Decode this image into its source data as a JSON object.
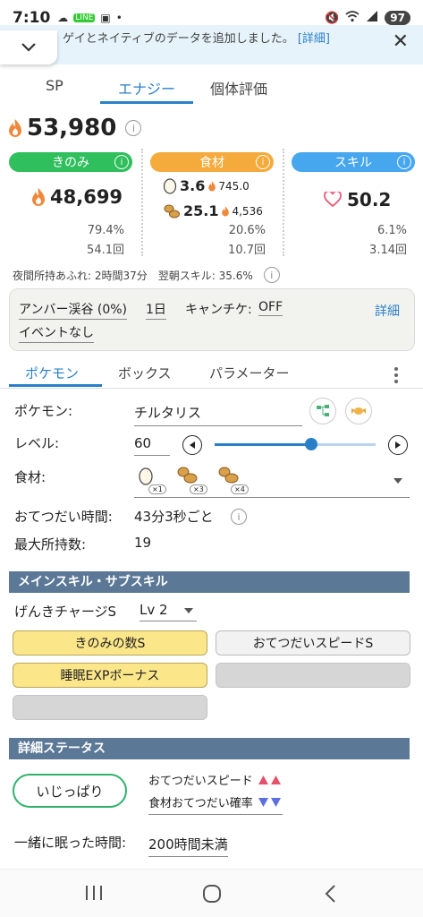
{
  "status_bar": {
    "time": "7:10",
    "battery": "97"
  },
  "banner": {
    "text": "ゲイとネイティブのデータを追加しました。",
    "link": "[詳細]"
  },
  "top_tabs": [
    "SP",
    "エナジー",
    "個体評価"
  ],
  "total_energy": "53,980",
  "categories": {
    "berry": {
      "label": "きのみ",
      "color": "#2fbf5c",
      "value": "48,699",
      "ratio": "79.4%",
      "count": "54.1回"
    },
    "ingredient": {
      "label": "食材",
      "color": "#f5ab3c",
      "egg_qty": "3.6",
      "egg_energy": "745.0",
      "nut_qty": "25.1",
      "nut_energy": "4,536",
      "ratio": "20.6%",
      "count": "10.7回"
    },
    "skill": {
      "label": "スキル",
      "color": "#46a6ee",
      "value": "50.2",
      "ratio": "6.1%",
      "count": "3.14回"
    }
  },
  "overflow": {
    "night": "夜間所持あふれ: 2時間37分",
    "morning": "翌朝スキル: 35.6%"
  },
  "settings": {
    "area": "アンバー渓谷 (0%)",
    "day": "1日",
    "ticket_label": "キャンチケ:",
    "ticket_value": "OFF",
    "detail": "詳細",
    "event": "イベントなし"
  },
  "sub_tabs": [
    "ポケモン",
    "ボックス",
    "パラメーター"
  ],
  "pokemon": {
    "name_label": "ポケモン:",
    "name": "チルタリス",
    "level_label": "レベル:",
    "level": "60",
    "level_fraction": 0.6,
    "ingredient_label": "食材:",
    "ing_counts": [
      "×1",
      "×3",
      "×4"
    ],
    "help_time_label": "おてつだい時間:",
    "help_time": "43分3秒ごと",
    "max_carry_label": "最大所持数:",
    "max_carry": "19"
  },
  "skills": {
    "header": "メインスキル・サブスキル",
    "main_skill": "げんきチャージS",
    "main_level": "Lv 2",
    "subs": [
      "きのみの数S",
      "おてつだいスピードS",
      "睡眠EXPボーナス"
    ]
  },
  "details": {
    "header": "詳細ステータス",
    "nature": "いじっぱり",
    "up_label": "おてつだいスピード",
    "down_label": "食材おてつだい確率",
    "sleep_label": "一緒に眠った時間:",
    "sleep_value": "200時間未満"
  }
}
